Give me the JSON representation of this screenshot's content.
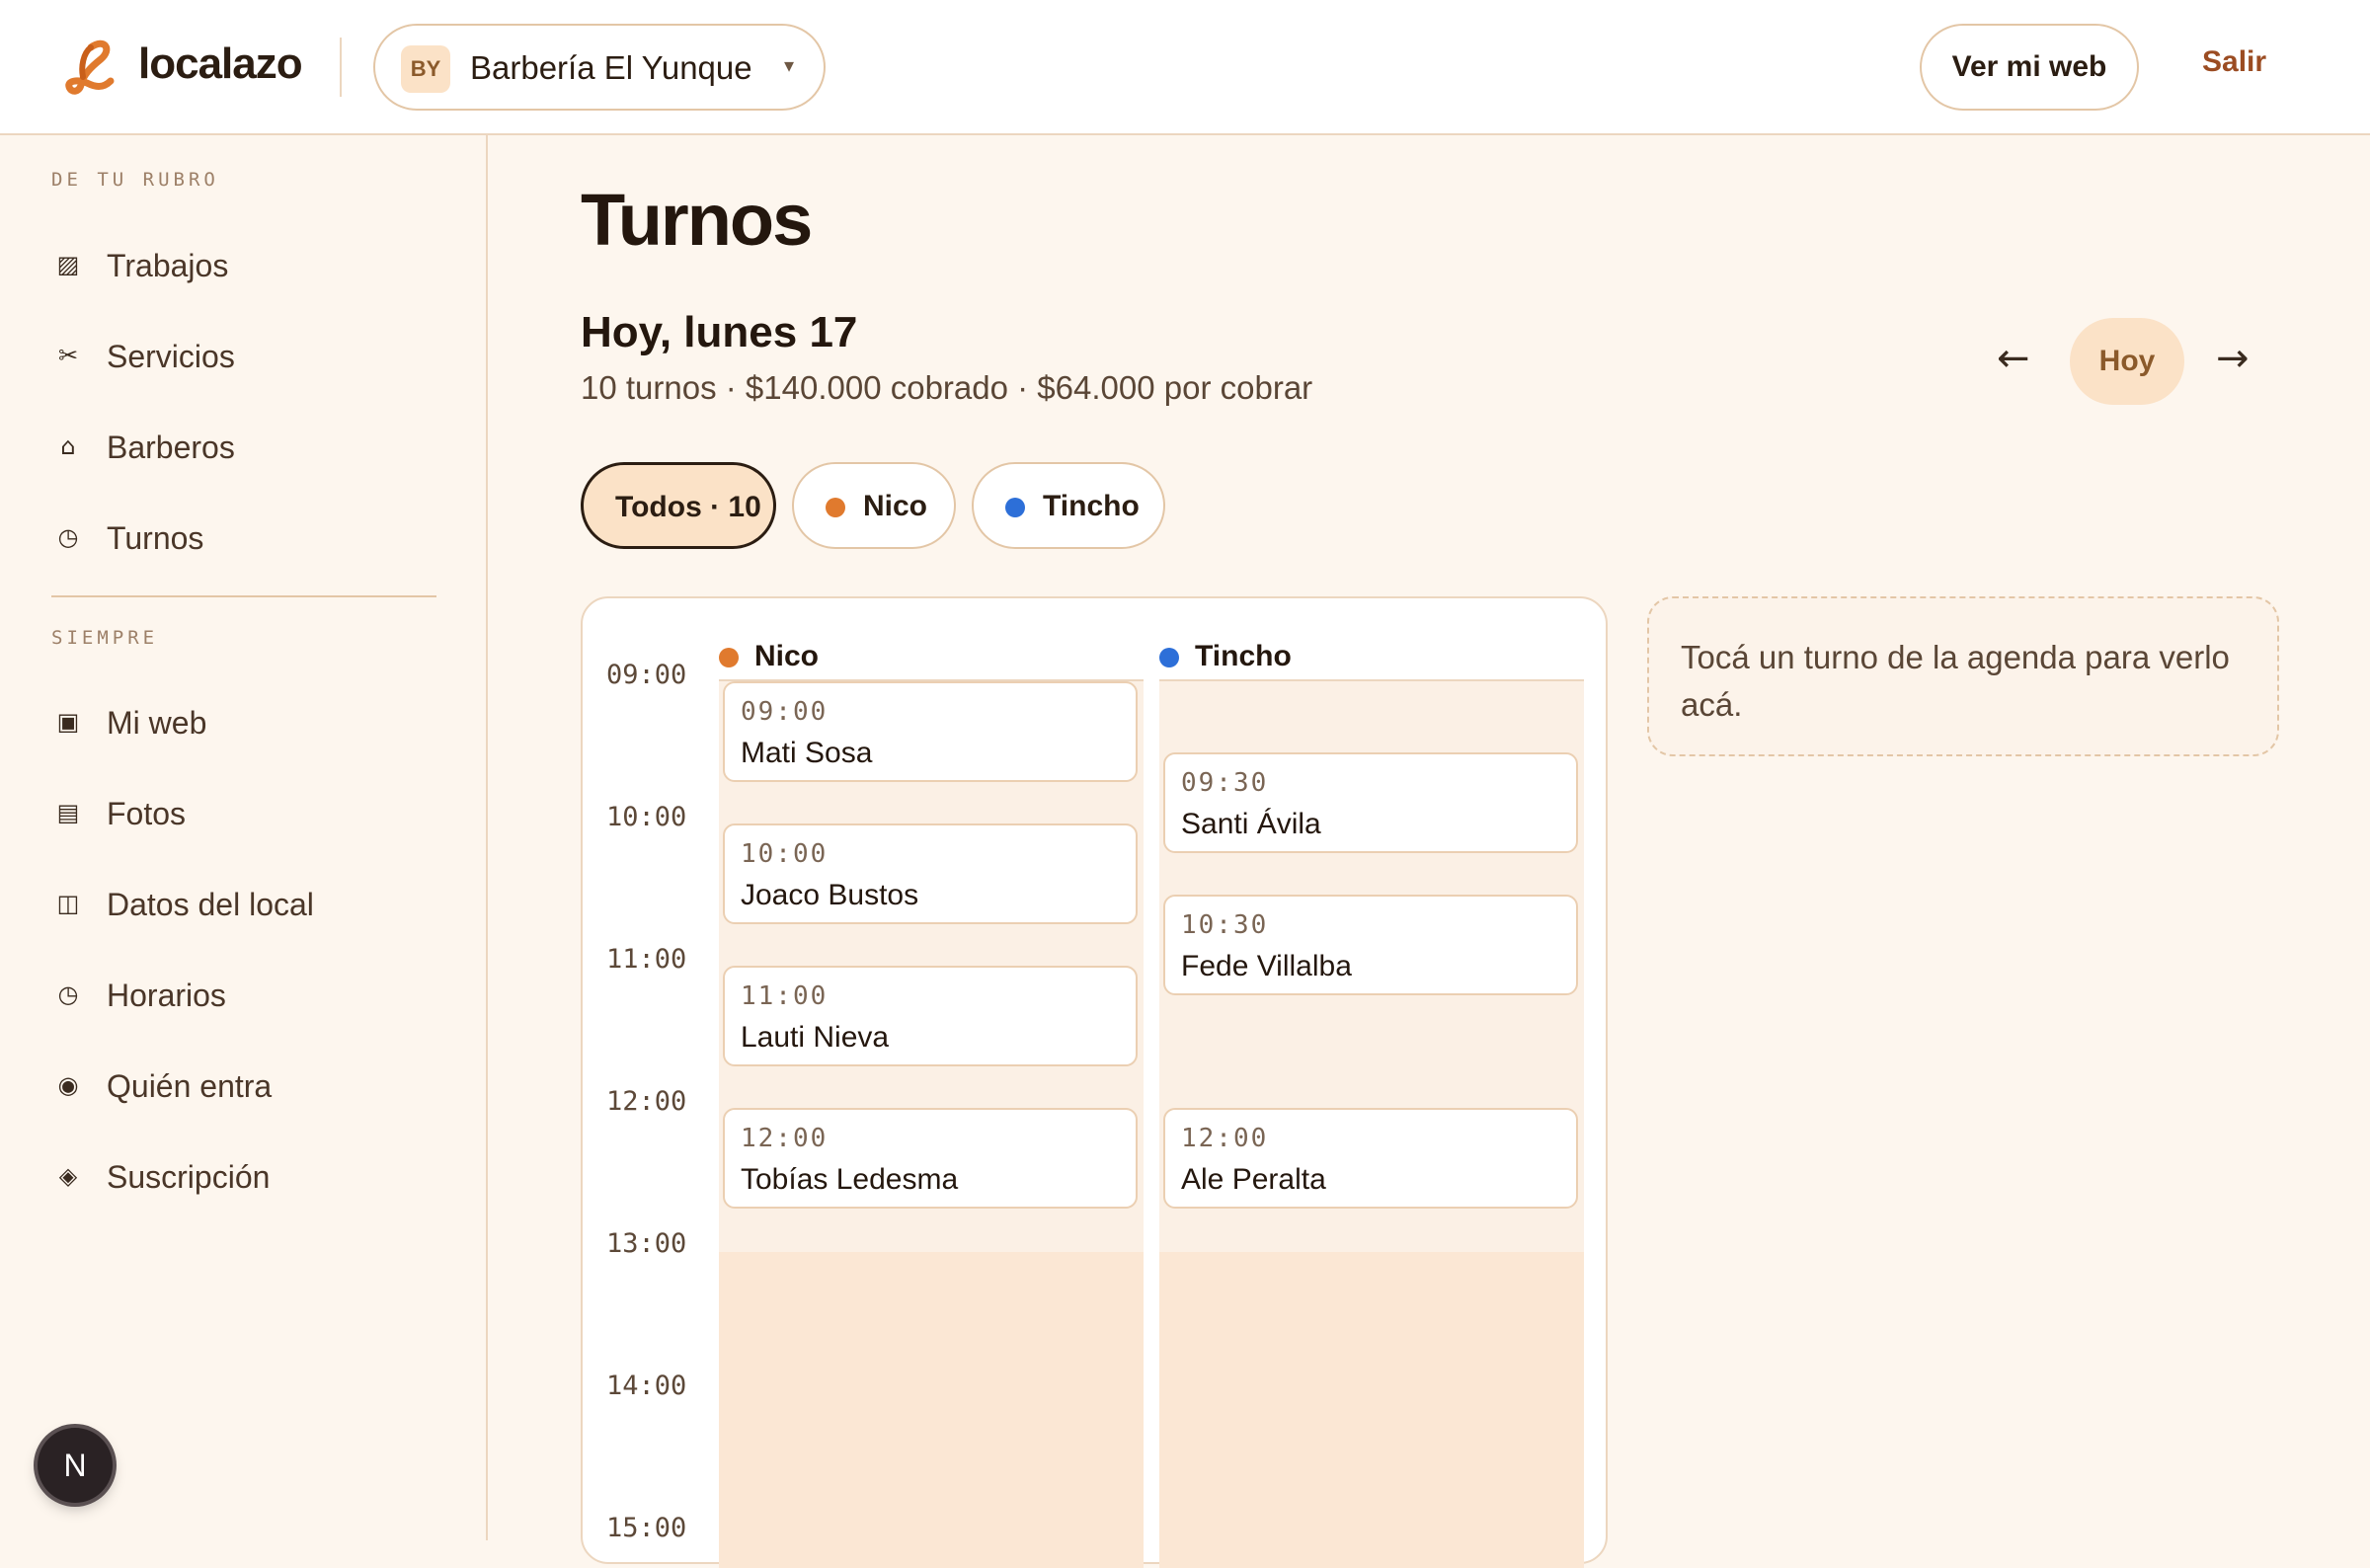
{
  "header": {
    "brand": "localazo",
    "business": {
      "initials": "BY",
      "name": "Barbería El Yunque",
      "caret": "▾"
    },
    "view_site": "Ver mi web",
    "logout": "Salir"
  },
  "sidebar": {
    "section_1": "DE TU RUBRO",
    "items_1": [
      {
        "label": "Trabajos",
        "icon": "▨",
        "icon_name": "grid-icon"
      },
      {
        "label": "Servicios",
        "icon": "✂",
        "icon_name": "scissors-icon"
      },
      {
        "label": "Barberos",
        "icon": "⌂",
        "icon_name": "home-icon"
      },
      {
        "label": "Turnos",
        "icon": "◷",
        "icon_name": "clock-icon"
      }
    ],
    "section_2": "SIEMPRE",
    "items_2": [
      {
        "label": "Mi web",
        "icon": "▣",
        "icon_name": "web-icon"
      },
      {
        "label": "Fotos",
        "icon": "▤",
        "icon_name": "photos-icon"
      },
      {
        "label": "Datos del local",
        "icon": "◫",
        "icon_name": "store-icon"
      },
      {
        "label": "Horarios",
        "icon": "◷",
        "icon_name": "clock-icon"
      },
      {
        "label": "Quién entra",
        "icon": "◉",
        "icon_name": "user-icon"
      },
      {
        "label": "Suscripción",
        "icon": "◈",
        "icon_name": "diamond-icon"
      }
    ],
    "badge": "N"
  },
  "main": {
    "title": "Turnos",
    "day_title": "Hoy, lunes 17",
    "summary": "10 turnos · $140.000 cobrado · $64.000 por cobrar",
    "nav": {
      "prev": "←",
      "today": "Hoy",
      "next": "→"
    },
    "filters": [
      {
        "label": "Todos · 10"
      },
      {
        "label": "Nico",
        "color": "#e07a2e"
      },
      {
        "label": "Tincho",
        "color": "#2d6fd8"
      }
    ]
  },
  "agenda": {
    "hours": [
      "09:00",
      "10:00",
      "11:00",
      "12:00",
      "13:00",
      "14:00",
      "15:00"
    ],
    "columns": [
      {
        "name": "Nico",
        "color": "#e07a2e",
        "slots": [
          {
            "time": "09:00",
            "client": "Mati Sosa"
          },
          {
            "time": "10:00",
            "client": "Joaco Bustos"
          },
          {
            "time": "11:00",
            "client": "Lauti Nieva"
          },
          {
            "time": "12:00",
            "client": "Tobías Ledesma"
          }
        ]
      },
      {
        "name": "Tincho",
        "color": "#2d6fd8",
        "slots": [
          {
            "time": "09:30",
            "client": "Santi Ávila"
          },
          {
            "time": "10:30",
            "client": "Fede Villalba"
          },
          {
            "time": "12:00",
            "client": "Ale Peralta"
          }
        ]
      }
    ]
  },
  "detail": {
    "placeholder": "Tocá un turno de la agenda para verlo acá."
  },
  "colors": {
    "accent": "#9b4c22",
    "background": "#fdf6ee",
    "nico": "#e07a2e",
    "tincho": "#2d6fd8"
  }
}
